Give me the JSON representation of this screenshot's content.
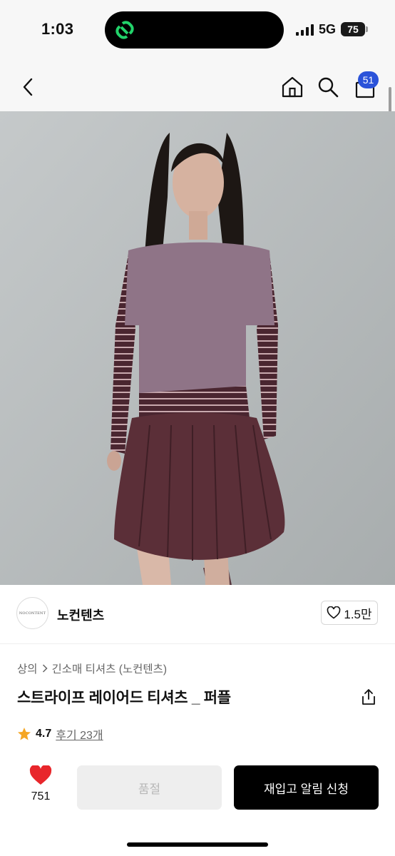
{
  "status_bar": {
    "time": "1:03",
    "network": "5G",
    "battery": "75",
    "island_app_icon": "link-chain-icon",
    "island_app_color": "#22d36a"
  },
  "nav": {
    "icons": [
      "back-arrow-icon",
      "home-icon",
      "search-icon",
      "shopping-bag-icon"
    ],
    "cart_badge": "51",
    "badge_color": "#2b53d9"
  },
  "product_image": {
    "description_icon": "product-photo"
  },
  "brand": {
    "logo_text": "NOCONTENT",
    "name": "노컨텐츠",
    "likes": "1.5만"
  },
  "product": {
    "breadcrumb": [
      "상의",
      "긴소매 티셔츠 (노컨텐츠)"
    ],
    "title": "스트라이프 레이어드 티셔츠 _ 퍼플",
    "rating": "4.7",
    "reviews": "후기 23개",
    "star_color": "#f5a623"
  },
  "actions": {
    "wish_count": "751",
    "heart_color": "#e8262b",
    "soldout_label": "품절",
    "restock_label": "재입고 알림 신청"
  }
}
